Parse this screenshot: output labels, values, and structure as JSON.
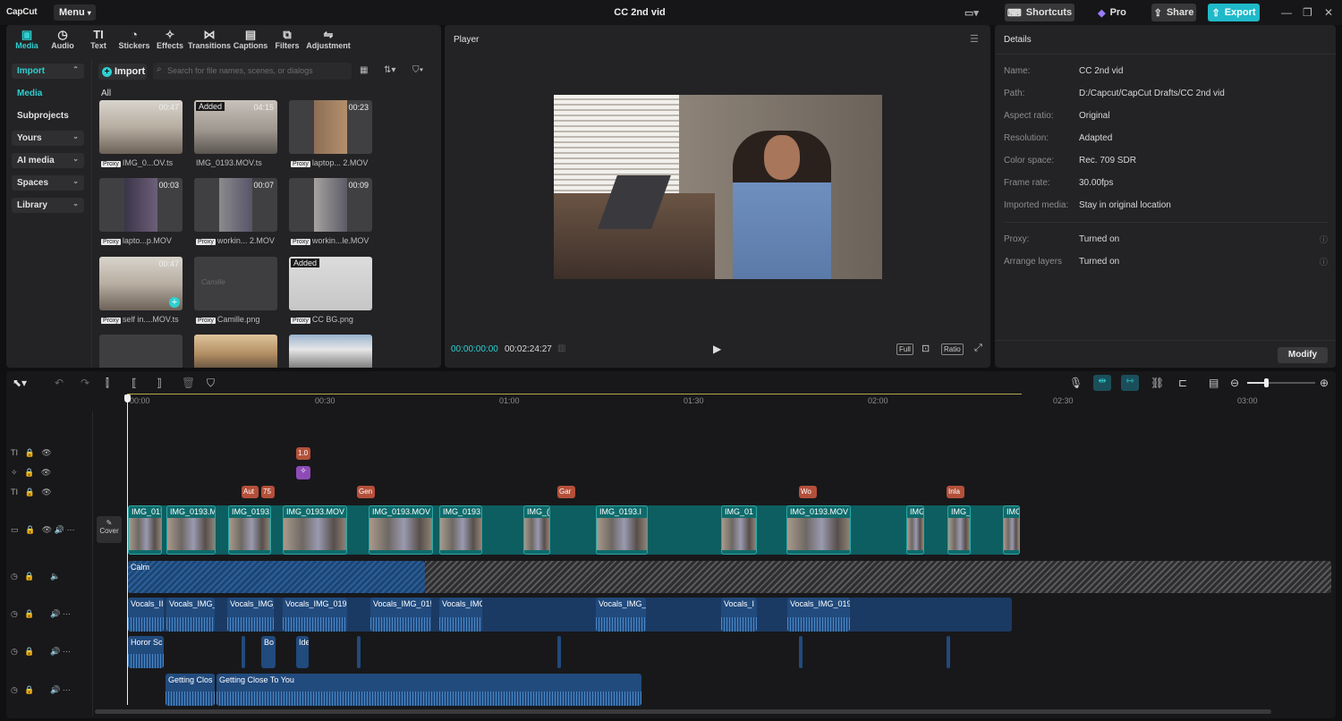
{
  "app": {
    "logo": "CapCut",
    "menu_label": "Menu",
    "title": "CC 2nd vid"
  },
  "topbar": {
    "shortcuts": "Shortcuts",
    "pro": "Pro",
    "share": "Share",
    "export": "Export"
  },
  "colors": {
    "accent": "#2fcfd0",
    "export_bg": "#1fb9c9",
    "video_clip": "#0f6b6b",
    "audio_clip": "#214a7d",
    "text_clip": "#b4503a",
    "sticker_clip": "#8e4bb8"
  },
  "media_tabs": [
    {
      "label": "Media",
      "icon": "media-icon"
    },
    {
      "label": "Audio",
      "icon": "audio-icon"
    },
    {
      "label": "Text",
      "icon": "text-icon"
    },
    {
      "label": "Stickers",
      "icon": "stickers-icon"
    },
    {
      "label": "Effects",
      "icon": "effects-icon"
    },
    {
      "label": "Transitions",
      "icon": "transitions-icon"
    },
    {
      "label": "Captions",
      "icon": "captions-icon"
    },
    {
      "label": "Filters",
      "icon": "filters-icon"
    },
    {
      "label": "Adjustment",
      "icon": "adjustment-icon"
    }
  ],
  "sidebar": {
    "import": "Import",
    "media": "Media",
    "subprojects": "Subprojects",
    "yours": "Yours",
    "ai_media": "AI media",
    "spaces": "Spaces",
    "library": "Library"
  },
  "media": {
    "import_btn": "Import",
    "search_placeholder": "Search for file names, scenes, or dialogs",
    "filter_all": "All",
    "proxy_tag": "Proxy",
    "added_tag": "Added",
    "items": [
      {
        "name": "IMG_0...OV.ts",
        "duration": "00:47",
        "proxy": true
      },
      {
        "name": "IMG_0193.MOV.ts",
        "duration": "04:15",
        "added": true
      },
      {
        "name": "laptop... 2.MOV",
        "duration": "00:23",
        "proxy": true
      },
      {
        "name": "lapto...p.MOV",
        "duration": "00:03",
        "proxy": true
      },
      {
        "name": "workin... 2.MOV",
        "duration": "00:07",
        "proxy": true
      },
      {
        "name": "workin...le.MOV",
        "duration": "00:09",
        "proxy": true
      },
      {
        "name": "self in....MOV.ts",
        "duration": "00:47",
        "proxy": true
      },
      {
        "name": "Camille.png",
        "duration": "",
        "proxy": true
      },
      {
        "name": "CC BG.png",
        "duration": "",
        "proxy": true,
        "added": true
      }
    ]
  },
  "player": {
    "title": "Player",
    "current_time": "00:00:00:00",
    "total_time": "00:02:24:27",
    "full": "Full",
    "ratio": "Ratio"
  },
  "details": {
    "title": "Details",
    "rows": [
      {
        "label": "Name:",
        "value": "CC 2nd vid"
      },
      {
        "label": "Path:",
        "value": "D:/Capcut/CapCut Drafts/CC 2nd vid"
      },
      {
        "label": "Aspect ratio:",
        "value": "Original"
      },
      {
        "label": "Resolution:",
        "value": "Adapted"
      },
      {
        "label": "Color space:",
        "value": "Rec. 709 SDR"
      },
      {
        "label": "Frame rate:",
        "value": "30.00fps"
      },
      {
        "label": "Imported media:",
        "value": "Stay in original location"
      },
      {
        "label": "Proxy:",
        "value": "Turned on"
      },
      {
        "label": "Arrange layers",
        "value": "Turned on"
      }
    ],
    "modify": "Modify"
  },
  "timeline": {
    "ruler": [
      "00:00",
      "00:30",
      "01:00",
      "01:30",
      "02:00",
      "02:30",
      "03:00"
    ],
    "cover": "Cover",
    "zoom_level": 0.28,
    "text_clips_top": [
      "1.0"
    ],
    "text_clips": [
      "Aut",
      "75",
      "Gen",
      "Gar",
      "Wo",
      "Inla"
    ],
    "video_clips": [
      "IMG_01!",
      "IMG_0193.M",
      "IMG_0193.",
      "IMG_0193.MOV",
      "IMG_0193.MOV",
      "IMG_0193.",
      "IMG_(",
      "IMG_0193.I",
      "IMG_01",
      "IMG_0193.MOV",
      "IMG_(",
      "IMG_",
      "IMG"
    ],
    "bg_music": "Calm",
    "vocals": [
      "Vocals_II",
      "Vocals_IMG_",
      "Vocals_IMG_",
      "Vocals_IMG_0193",
      "Vocals_IMG_01!",
      "Vocals_IMG",
      "Vocals_IMG_",
      "Vocals_I",
      "Vocals_IMG_019"
    ],
    "sfx": [
      "Horor Sc",
      "Bo",
      "Ide"
    ],
    "song": [
      "Getting Clos",
      "Getting Close To You"
    ]
  }
}
